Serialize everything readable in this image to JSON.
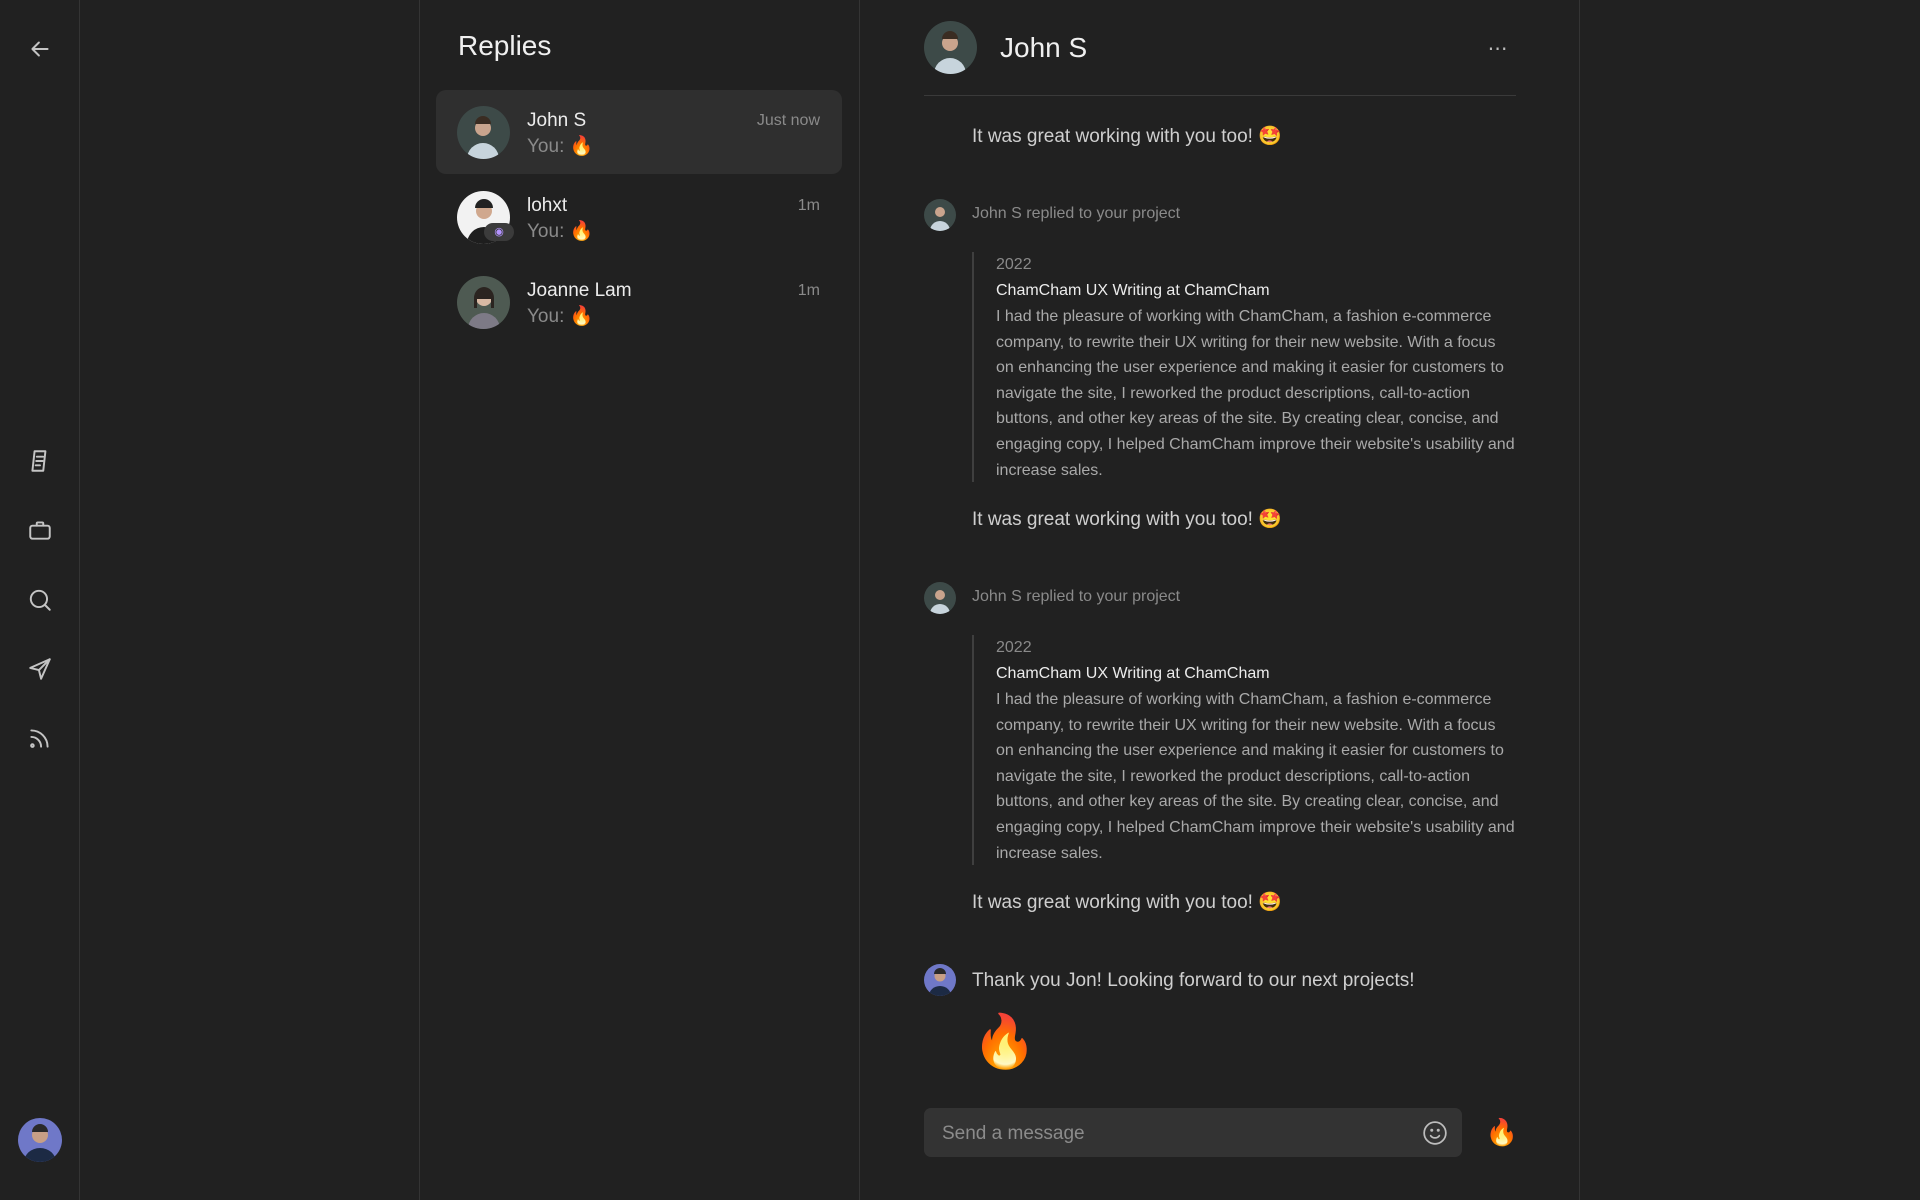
{
  "rail": {
    "icons": [
      "back-arrow-icon",
      "document-icon",
      "briefcase-icon",
      "search-icon",
      "send-icon",
      "feed-icon"
    ]
  },
  "list": {
    "title": "Replies",
    "conversations": [
      {
        "name": "John S",
        "preview": "You: 🔥",
        "time": "Just now",
        "active": true
      },
      {
        "name": "lohxt",
        "preview": "You: 🔥",
        "time": "1m",
        "active": false
      },
      {
        "name": "Joanne Lam",
        "preview": "You: 🔥",
        "time": "1m",
        "active": false
      }
    ]
  },
  "chat": {
    "title": "John S",
    "messages": [
      {
        "text": "It was great working with you too! 🤩"
      },
      {
        "reply_label": "John S replied to your project",
        "year": "2022",
        "project_title": "ChamCham UX Writing at ChamCham",
        "project_desc": "I had the pleasure of working with ChamCham, a fashion e-commerce company, to rewrite their UX writing for their new website. With a focus on enhancing the user experience and making it easier for customers to navigate the site, I reworked the product descriptions, call-to-action buttons, and other key areas of the site. By creating clear, concise, and engaging copy, I helped ChamCham improve their website's usability and increase sales.",
        "text": "It was great working with you too! 🤩"
      },
      {
        "reply_label": "John S replied to your project",
        "year": "2022",
        "project_title": "ChamCham UX Writing at ChamCham",
        "project_desc": "I had the pleasure of working with ChamCham, a fashion e-commerce company, to rewrite their UX writing for their new website. With a focus on enhancing the user experience and making it easier for customers to navigate the site, I reworked the product descriptions, call-to-action buttons, and other key areas of the site. By creating clear, concise, and engaging copy, I helped ChamCham improve their website's usability and increase sales.",
        "text": "It was great working with you too! 🤩"
      }
    ],
    "my_message": "Thank you Jon! Looking forward to our next projects!",
    "my_emoji": "🔥",
    "composer": {
      "placeholder": "Send a message",
      "value": ""
    },
    "quick_reaction": "🔥"
  },
  "colors": {
    "background": "#212121",
    "active_row": "#2f2f2f",
    "composer_bg": "#333333",
    "muted_text": "#8a8a8a"
  }
}
